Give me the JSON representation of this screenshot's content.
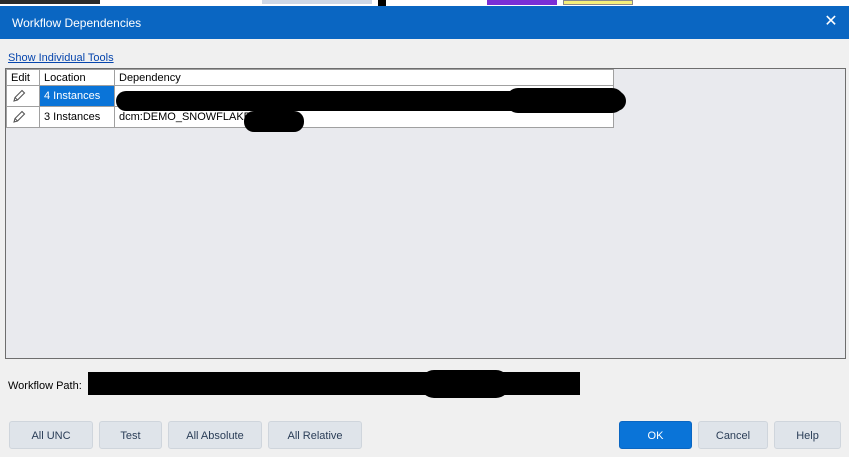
{
  "dialog": {
    "title": "Workflow Dependencies",
    "close_glyph": "✕"
  },
  "links": {
    "show_individual_tools": "Show Individual Tools"
  },
  "table": {
    "headers": [
      "Edit",
      "Location",
      "Dependency"
    ],
    "rows": [
      {
        "location": "4 Instances",
        "dependency": "",
        "selected": true
      },
      {
        "location": "3 Instances",
        "dependency": "dcm:DEMO_SNOWFLAKE",
        "selected": false
      }
    ]
  },
  "workflow_path": {
    "label": "Workflow Path:"
  },
  "buttons": {
    "all_unc": "All UNC",
    "test": "Test",
    "all_absolute": "All Absolute",
    "all_relative": "All Relative",
    "ok": "OK",
    "cancel": "Cancel",
    "help": "Help"
  },
  "colors": {
    "accent": "#0a66c2",
    "selection": "#0a74d8",
    "link": "#0645ad"
  },
  "icons": {
    "edit": "pencil-icon",
    "close": "close-icon"
  }
}
